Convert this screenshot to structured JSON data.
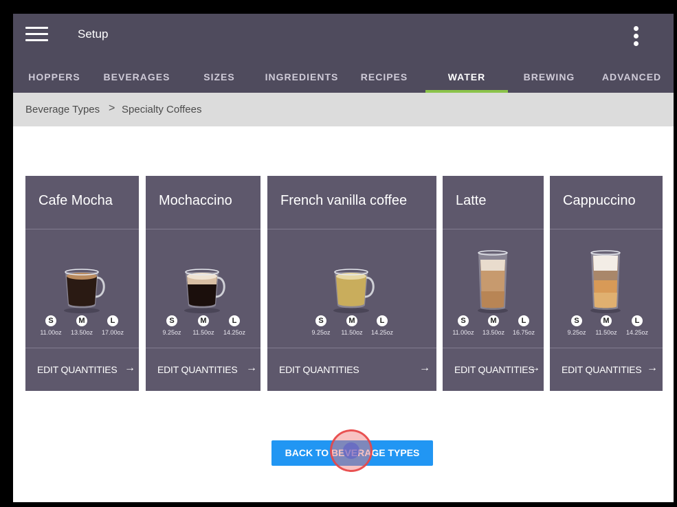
{
  "header": {
    "title": "Setup"
  },
  "tabs": [
    {
      "label": "HOPPERS"
    },
    {
      "label": "BEVERAGES"
    },
    {
      "label": "SIZES"
    },
    {
      "label": "INGREDIENTS"
    },
    {
      "label": "RECIPES"
    },
    {
      "label": "WATER",
      "active": true
    },
    {
      "label": "BREWING"
    },
    {
      "label": "ADVANCED"
    }
  ],
  "breadcrumb": {
    "parent": "Beverage Types",
    "separator": ">",
    "current": "Specialty Coffees"
  },
  "size_letters": {
    "s": "S",
    "m": "M",
    "l": "L"
  },
  "beverages": [
    {
      "name": "Cafe Mocha",
      "sizes": [
        "11.00oz",
        "13.50oz",
        "17.00oz"
      ],
      "action": "EDIT QUANTITIES",
      "arrow": "→"
    },
    {
      "name": "Mochaccino",
      "sizes": [
        "9.25oz",
        "11.50oz",
        "14.25oz"
      ],
      "action": "EDIT QUANTITIES",
      "arrow": "→"
    },
    {
      "name": "French vanilla coffee",
      "sizes": [
        "9.25oz",
        "11.50oz",
        "14.25oz"
      ],
      "action": "EDIT QUANTITIES",
      "arrow": "→"
    },
    {
      "name": "Latte",
      "sizes": [
        "11.00oz",
        "13.50oz",
        "16.75oz"
      ],
      "action": "EDIT QUANTITIES",
      "arrow": "→"
    },
    {
      "name": "Cappuccino",
      "sizes": [
        "9.25oz",
        "11.50oz",
        "14.25oz"
      ],
      "action": "EDIT QUANTITIES",
      "arrow": "→"
    }
  ],
  "footer": {
    "back_label": "BACK TO BEVERAGE TYPES"
  },
  "colors": {
    "appbar": "#4f4b5d",
    "card": "#5e586c",
    "accent_tab": "#8bc34a",
    "primary_button": "#2196f3"
  }
}
